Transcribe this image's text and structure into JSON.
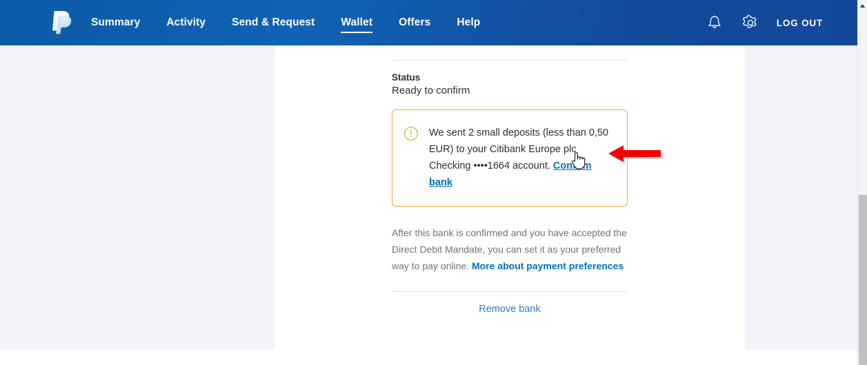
{
  "header": {
    "logo_icon": "paypal-logo-icon",
    "nav": [
      {
        "label": "Summary",
        "active": false
      },
      {
        "label": "Activity",
        "active": false
      },
      {
        "label": "Send & Request",
        "active": false
      },
      {
        "label": "Wallet",
        "active": true
      },
      {
        "label": "Offers",
        "active": false
      },
      {
        "label": "Help",
        "active": false
      }
    ],
    "notifications_icon": "bell-icon",
    "settings_icon": "gear-icon",
    "logout_label": "LOG OUT",
    "background_color": "#0f62b4"
  },
  "main": {
    "status_label": "Status",
    "status_value": "Ready to confirm",
    "alert": {
      "icon": "warning-circle-icon",
      "border_color": "#eaa935",
      "text_before": "We sent 2 small deposits (less than 0,50 EUR) to your Citibank Europe plc Checking ••••1664 account. ",
      "link_label": "Confirm bank"
    },
    "note": {
      "text_before": "After this bank is confirmed and you have accepted the Direct Debit Mandate, you can set it as your preferred way to pay online. ",
      "link_label": "More about payment preferences",
      "link_color": "#0070ba"
    },
    "remove_label": "Remove bank"
  },
  "annotations": {
    "arrow_color": "#f00000",
    "arrow_direction": "left",
    "cursor_type": "pointing-hand"
  },
  "scrollbar": {
    "up_arrow_icon": "scroll-up-arrow-icon",
    "thumb_color": "#c0c0c4"
  }
}
